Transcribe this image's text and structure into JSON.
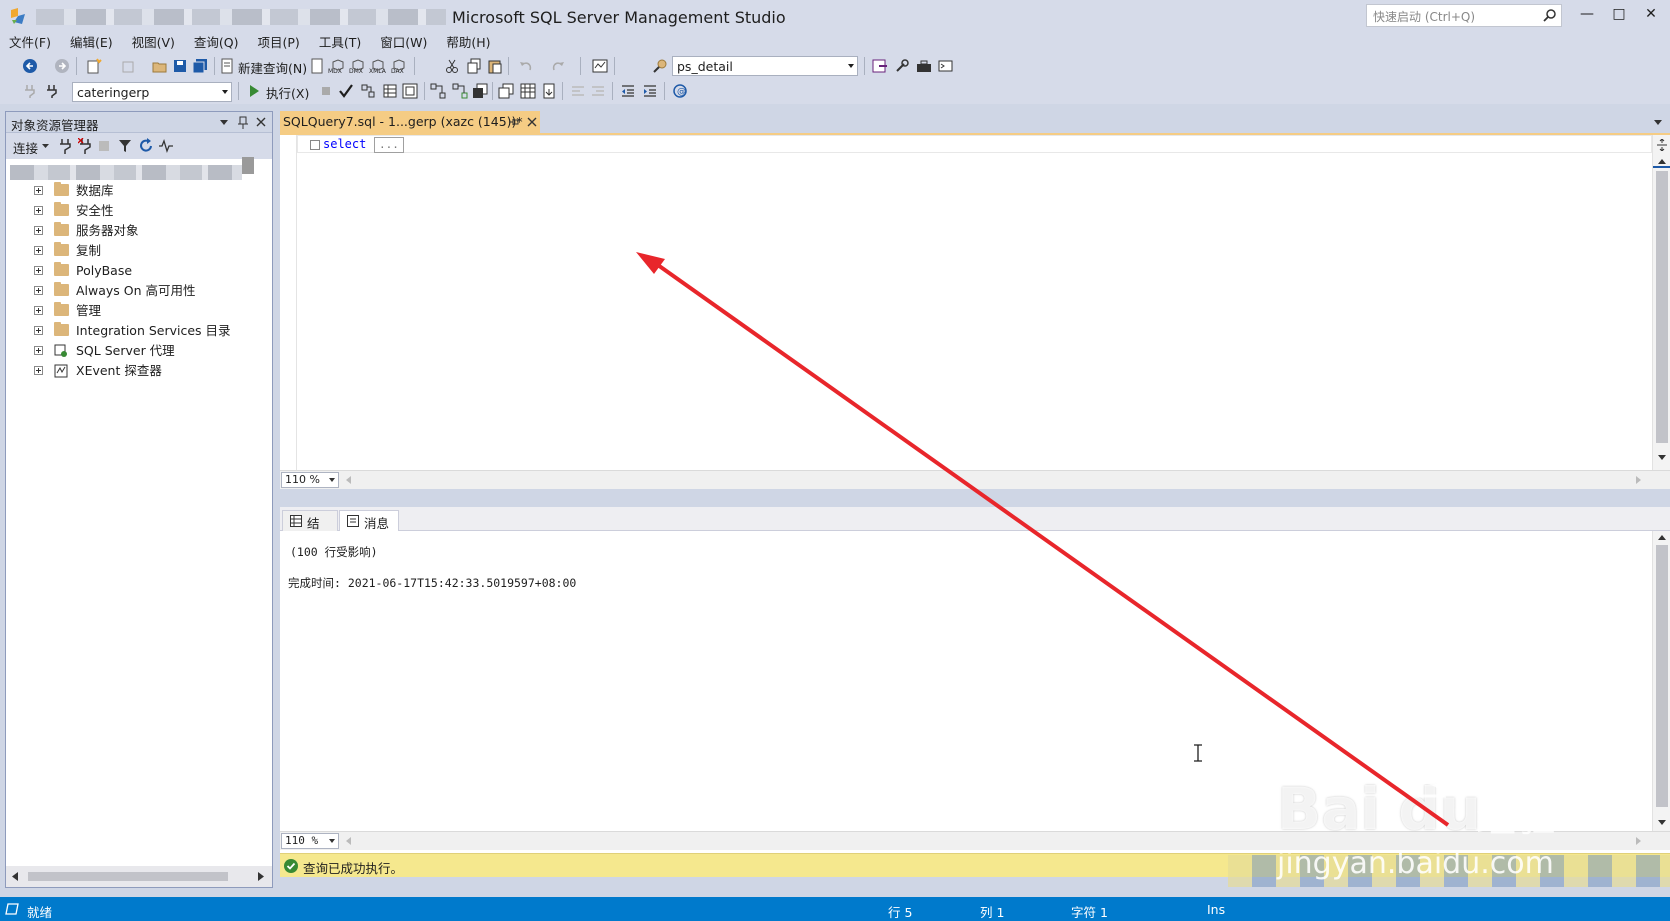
{
  "window": {
    "title": "Microsoft SQL Server Management Studio",
    "quick_launch_placeholder": "快速启动 (Ctrl+Q)",
    "minimize": "—",
    "maximize": "□",
    "close": "✕"
  },
  "menu": [
    "文件(F)",
    "编辑(E)",
    "视图(V)",
    "查询(Q)",
    "项目(P)",
    "工具(T)",
    "窗口(W)",
    "帮助(H)"
  ],
  "toolbar1": {
    "new_query_label": "新建查询(N)",
    "mdx": "MDX",
    "dmx": "DMX",
    "xmla": "XMLA",
    "dax": "DAX",
    "object_combo": "ps_detail"
  },
  "toolbar2": {
    "database_combo": "cateringerp",
    "execute_label": "执行(X)"
  },
  "object_explorer": {
    "title": "对象资源管理器",
    "connect_label": "连接",
    "tree": [
      {
        "label": "数据库",
        "icon": "folder"
      },
      {
        "label": "安全性",
        "icon": "folder"
      },
      {
        "label": "服务器对象",
        "icon": "folder"
      },
      {
        "label": "复制",
        "icon": "folder"
      },
      {
        "label": "PolyBase",
        "icon": "folder"
      },
      {
        "label": "Always On 高可用性",
        "icon": "folder"
      },
      {
        "label": "管理",
        "icon": "folder"
      },
      {
        "label": "Integration Services 目录",
        "icon": "folder"
      },
      {
        "label": "SQL Server 代理",
        "icon": "agent"
      },
      {
        "label": "XEvent 探查器",
        "icon": "xevent"
      }
    ]
  },
  "document": {
    "tab_title": "SQLQuery7.sql - 1...gerp (xazc (145))*",
    "code_keyword": "select",
    "collapsed_text": "...",
    "editor_zoom": "110 %"
  },
  "results": {
    "tabs": [
      "结果",
      "消息"
    ],
    "active_tab": "消息",
    "messages": [
      "(100 行受影响)",
      "完成时间: 2021-06-17T15:42:33.5019597+08:00"
    ],
    "zoom": "110 %",
    "query_status": "查询已成功执行。"
  },
  "statusbar": {
    "state": "就绪",
    "row": "行 5",
    "col": "列 1",
    "char": "字符 1",
    "mode": "Ins"
  },
  "watermark": {
    "brand": "Bai",
    "brand_tail": "du",
    "brand_cn": "经验",
    "url": "jingyan.baidu.com"
  },
  "colors": {
    "accent": "#007acc",
    "tab_active": "#f5cc84",
    "success_bar": "#f5e88e",
    "annotation": "#e8262b"
  }
}
